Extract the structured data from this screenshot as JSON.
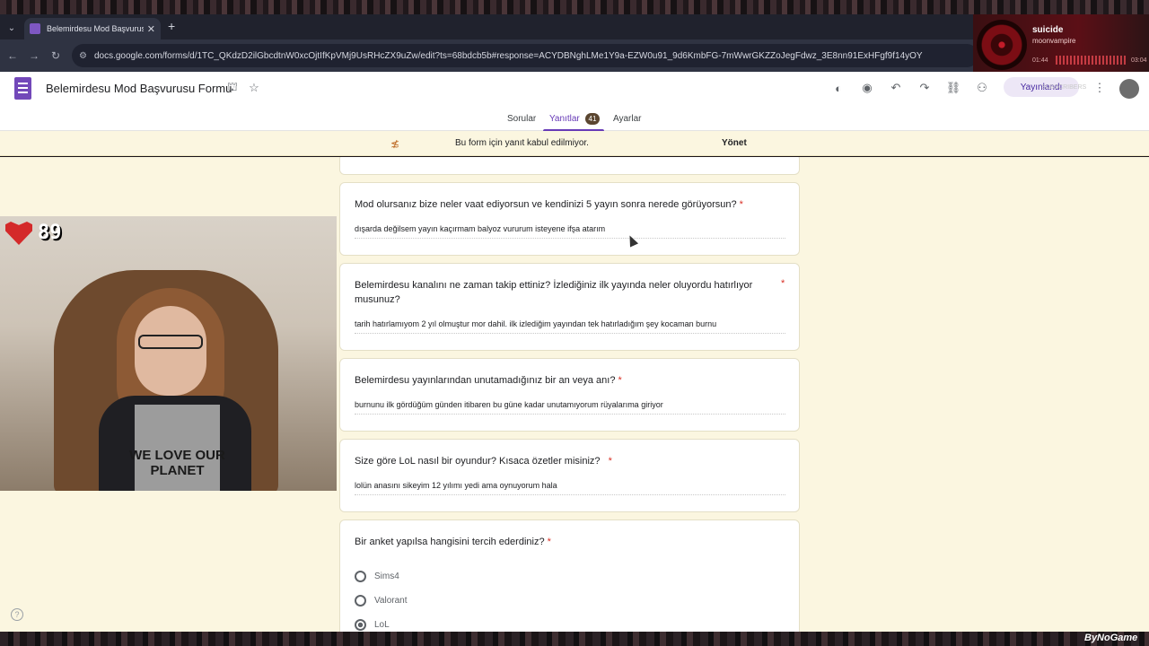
{
  "browser": {
    "tab_title": "Belemirdesu Mod Başvurusu Fo",
    "url": "docs.google.com/forms/d/1TC_QKdzD2ilGbcdtnW0xcOjtIfKpVMj9UsRHcZX9uZw/edit?ts=68bdcb5b#response=ACYDBNghLMe1Y9a-EZW0u91_9d6KmbFG-7mWwrGKZZoJegFdwz_3E8nn91ExHFgf9f14yOY"
  },
  "media": {
    "title": "suicide",
    "artist": "moonvampire",
    "time_elapsed": "01:44",
    "time_total": "03:04"
  },
  "form": {
    "title": "Belemirdesu Mod Başvurusu Formu",
    "publish_label": "Yayınlandı",
    "overlay_label": "SUBSCRIBERS",
    "tabs": [
      {
        "label": "Sorular"
      },
      {
        "label": "Yanıtlar",
        "count": "41"
      },
      {
        "label": "Ayarlar"
      }
    ]
  },
  "notice": {
    "text": "Bu form için yanıt kabul edilmiyor.",
    "action": "Yönet"
  },
  "questions": [
    {
      "title": "Mod olursanız bize neler vaat ediyorsun ve kendinizi 5 yayın sonra nerede görüyorsun?",
      "answer": "dışarda değilsem yayın kaçırmam balyoz vururum isteyene ifşa atarım"
    },
    {
      "title": "Belemirdesu kanalını ne zaman takip ettiniz? İzlediğiniz ilk yayında neler oluyordu hatırlıyor musunuz?",
      "answer": "tarih hatırlamıyom 2 yıl olmuştur mor dahil. ilk izlediğim yayından tek hatırladığım şey kocaman burnu"
    },
    {
      "title": "Belemirdesu yayınlarından unutamadığınız bir an veya anı?",
      "answer": "burnunu ilk gördüğüm günden itibaren bu güne kadar unutamıyorum rüyalarıma giriyor"
    },
    {
      "title": "Size göre LoL nasıl bir oyundur? Kısaca özetler misiniz?",
      "answer": "lolün anasını sikeyim 12 yılımı yedi ama oynuyorum hala"
    },
    {
      "title": "Bir anket yapılsa hangisini tercih ederdiniz?",
      "options": [
        "Sims4",
        "Valorant",
        "LoL"
      ]
    }
  ],
  "required_mark": "*",
  "webcam": {
    "heart_count": "89",
    "shirt_text": "WE LOVE OUR PLANET"
  },
  "brand": "ByNoGame",
  "colors": {
    "accent": "#673ab7",
    "background": "#fbf6e0",
    "required": "#d93025"
  }
}
